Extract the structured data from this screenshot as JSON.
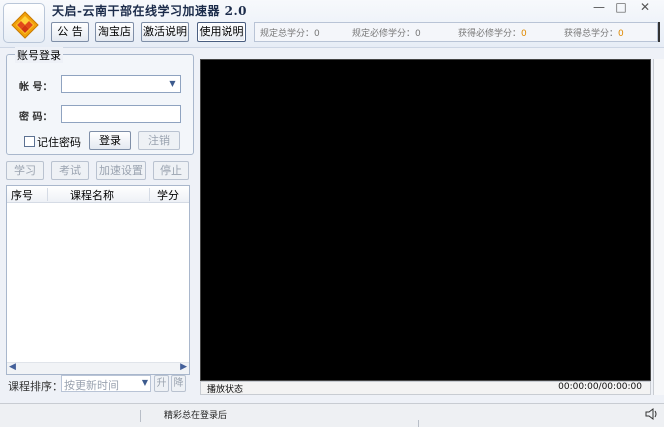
{
  "window": {
    "title": "天启-云南干部在线学习加速器 2.0",
    "minimize_glyph": "—",
    "maximize_glyph": "□",
    "close_glyph": "✕",
    "logo_icon": "diamond-logo-icon"
  },
  "toolbar": {
    "notice": "公 告",
    "taobao": "淘宝店",
    "activation": "激活说明",
    "usage": "使用说明"
  },
  "stats": {
    "required_total_label": "规定总学分：",
    "required_total_value": "0",
    "required_mandatory_label": "规定必修学分：",
    "required_mandatory_value": "0",
    "earned_mandatory_label": "获得必修学分：",
    "earned_mandatory_value": "0",
    "earned_total_label": "获得总学分：",
    "earned_total_value": "0"
  },
  "login": {
    "legend": "账号登录",
    "account_label": "帐  号：",
    "account_value": "",
    "password_label": "密  码：",
    "password_value": "",
    "remember_label": "记住密码",
    "login_button": "登录",
    "logout_button": "注销"
  },
  "actions": {
    "study": "学习",
    "exam": "考试",
    "speed_settings": "加速设置",
    "stop": "停止"
  },
  "course_table": {
    "columns": [
      "序号",
      "课程名称",
      "学分"
    ],
    "rows": []
  },
  "sort": {
    "label": "课程排序：",
    "selected": "按更新时间",
    "up": "升",
    "down": "降"
  },
  "player": {
    "status_label": "播放状态",
    "time": "00:00:00/00:00:00"
  },
  "statusbar": {
    "message": "精彩总在登录后"
  },
  "colors": {
    "accent_orange": "#e08a00",
    "video_bg": "#000000",
    "window_bg": "#eef1f7"
  }
}
